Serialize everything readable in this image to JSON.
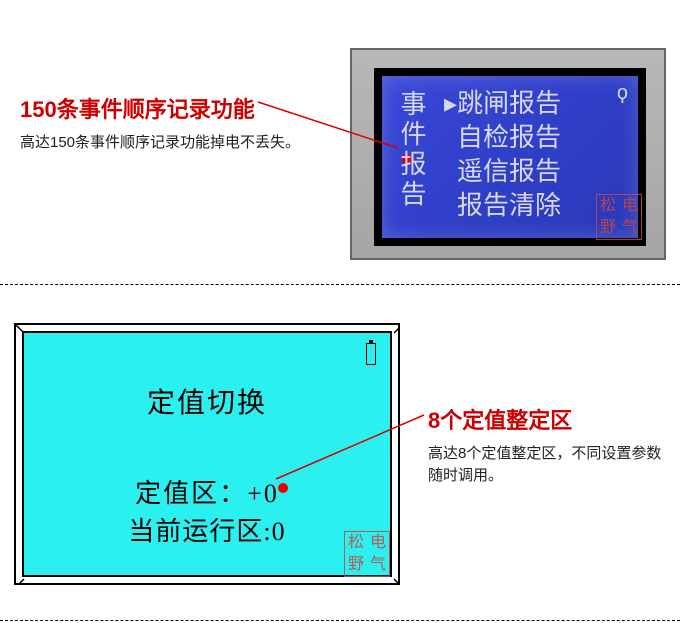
{
  "section1": {
    "headline": "150条事件顺序记录功能",
    "description": "高达150条事件顺序记录功能掉电不丢失。",
    "lcd": {
      "left_label": "事件报告",
      "menu_items": [
        "跳闸报告",
        "自检报告",
        "遥信报告",
        "报告清除"
      ],
      "selected_index": 0,
      "corner_glyph": "ϙ"
    },
    "stamp": {
      "c1": "松",
      "c2": "电",
      "c3": "野",
      "c4": "气"
    }
  },
  "section2": {
    "headline": "8个定值整定区",
    "description": "高达8个定值整定区，不同设置参数随时调用。",
    "screen": {
      "title": "定值切换",
      "line1_label": "定值区：",
      "line1_value": "+0",
      "line2_label": "当前运行区",
      "line2_value": ":0"
    },
    "stamp": {
      "c1": "松",
      "c2": "电",
      "c3": "野",
      "c4": "气"
    }
  }
}
